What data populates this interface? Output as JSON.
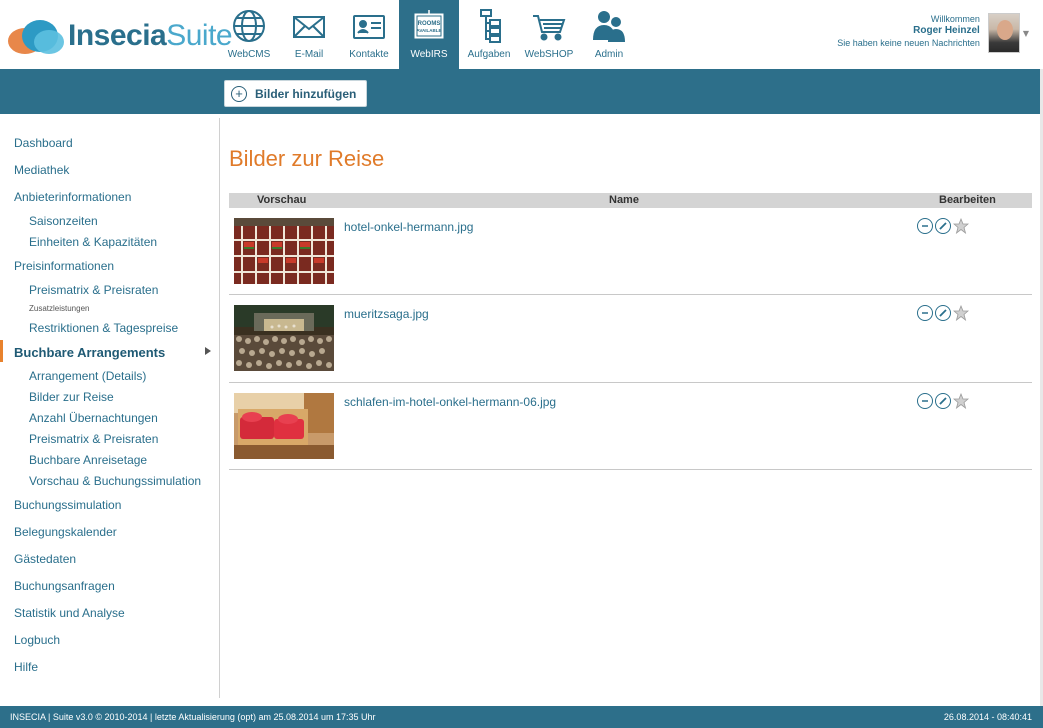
{
  "logo": {
    "part1": "Insecia",
    "part2": "Suite"
  },
  "nav": [
    {
      "label": "WebCMS",
      "icon": "globe-icon"
    },
    {
      "label": "E-Mail",
      "icon": "envelope-icon"
    },
    {
      "label": "Kontakte",
      "icon": "contact-card-icon"
    },
    {
      "label": "WebIRS",
      "icon": "rooms-available-sign-icon",
      "active": true,
      "sign_line1": "ROOMS",
      "sign_line2": "AVAILABLE"
    },
    {
      "label": "Aufgaben",
      "icon": "task-tree-icon"
    },
    {
      "label": "WebSHOP",
      "icon": "shopping-cart-icon"
    },
    {
      "label": "Admin",
      "icon": "users-icon"
    }
  ],
  "user": {
    "greeting": "Willkommen",
    "name": "Roger Heinzel",
    "messages": "Sie haben keine neuen Nachrichten"
  },
  "toolbar": {
    "add_label": "Bilder hinzufügen"
  },
  "sidebar": {
    "dashboard": "Dashboard",
    "mediathek": "Mediathek",
    "anbieter": "Anbieterinformationen",
    "saison": "Saisonzeiten",
    "einheiten": "Einheiten & Kapazitäten",
    "preisinfo": "Preisinformationen",
    "preismatrix1": "Preismatrix & Preisraten",
    "zusatz": "Zusatzleistungen",
    "restrik": "Restriktionen & Tagespreise",
    "buchbare": "Buchbare Arrangements",
    "arr_details": "Arrangement (Details)",
    "bilder": "Bilder zur Reise",
    "anzahl": "Anzahl Übernachtungen",
    "preismatrix2": "Preismatrix & Preisraten",
    "anreise": "Buchbare Anreisetage",
    "vorschau": "Vorschau & Buchungssimulation",
    "buchungssim": "Buchungssimulation",
    "belegung": "Belegungskalender",
    "gaeste": "Gästedaten",
    "anfragen": "Buchungsanfragen",
    "statistik": "Statistik und Analyse",
    "logbuch": "Logbuch",
    "hilfe": "Hilfe"
  },
  "main": {
    "title": "Bilder zur Reise",
    "columns": {
      "preview": "Vorschau",
      "name": "Name",
      "edit": "Bearbeiten"
    },
    "rows": [
      {
        "name": "hotel-onkel-hermann.jpg"
      },
      {
        "name": "mueritzsaga.jpg"
      },
      {
        "name": "schlafen-im-hotel-onkel-hermann-06.jpg"
      }
    ]
  },
  "footer": {
    "left": "INSECIA | Suite v3.0 © 2010-2014 | letzte Aktualisierung (opt) am 25.08.2014 um 17:35 Uhr",
    "right": "26.08.2014 - 08:40:41"
  },
  "colors": {
    "brand": "#2d6f8a",
    "accent": "#e07b2a",
    "link": "#2a6f8c"
  }
}
